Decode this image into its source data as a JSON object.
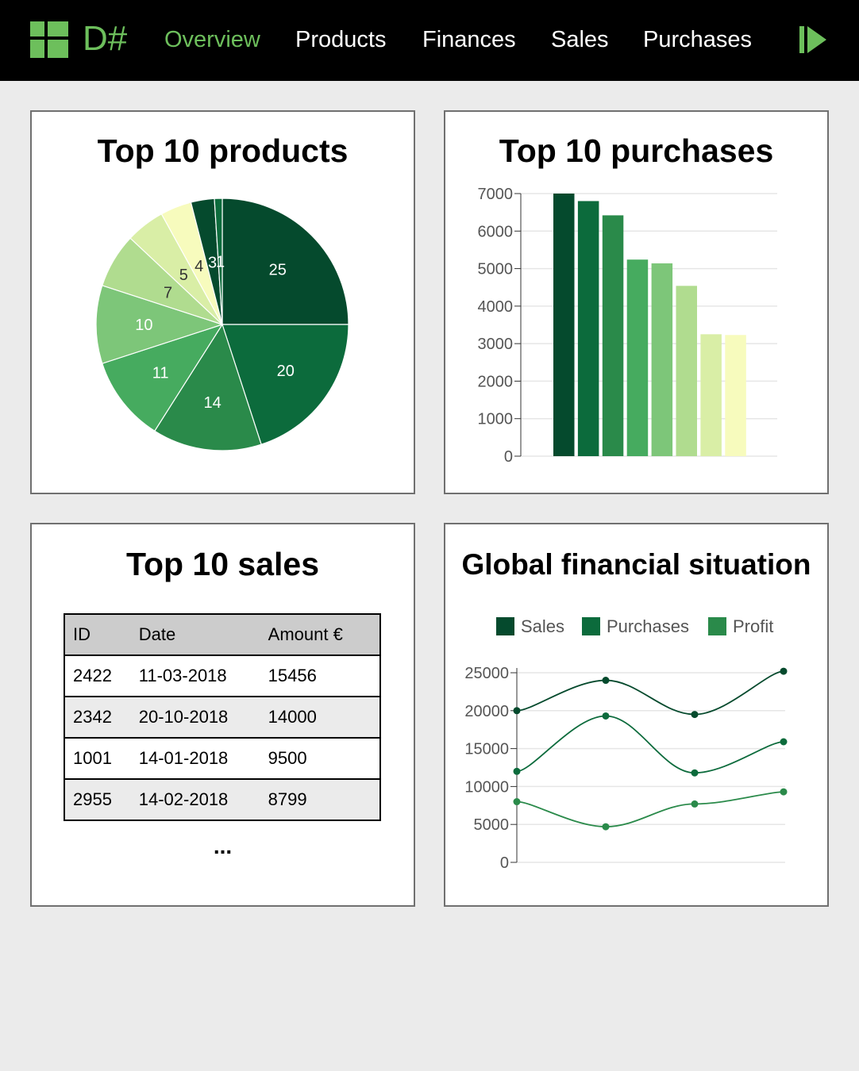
{
  "header": {
    "logo_text": "D#",
    "nav": [
      {
        "label": "Overview",
        "active": true
      },
      {
        "label": "Products",
        "active": false
      },
      {
        "label": "Finances",
        "active": false
      },
      {
        "label": "Sales",
        "active": false
      },
      {
        "label": "Purchases",
        "active": false
      }
    ],
    "logout_icon": "logout-play-icon",
    "accent_color": "#6dbf5c"
  },
  "products_panel": {
    "title": "Top 10 products"
  },
  "purchases_panel": {
    "title": "Top 10 purchases"
  },
  "sales_panel": {
    "title": "Top 10 sales",
    "columns": [
      "ID",
      "Date",
      "Amount €"
    ],
    "rows": [
      [
        "2422",
        "11-03-2018",
        "15456"
      ],
      [
        "2342",
        "20-10-2018",
        "14000"
      ],
      [
        "1001",
        "14-01-2018",
        "9500"
      ],
      [
        "2955",
        "14-02-2018",
        "8799"
      ]
    ],
    "more": "..."
  },
  "finance_panel": {
    "title": "Global financial situation"
  },
  "chart_data": [
    {
      "type": "pie",
      "title": "Top 10 products",
      "values": [
        25,
        20,
        14,
        11,
        10,
        7,
        5,
        4,
        3,
        1
      ],
      "colors": [
        "#054a2d",
        "#0c6b3c",
        "#2a8a4a",
        "#46ab5f",
        "#7dc679",
        "#b0dc8f",
        "#d9eea6",
        "#f7fbbd",
        "#054a2d",
        "#0c6b3c"
      ]
    },
    {
      "type": "bar",
      "title": "Top 10 purchases",
      "values": [
        7000,
        6800,
        6420,
        5240,
        5140,
        4540,
        3250,
        3230
      ],
      "colors": [
        "#054a2d",
        "#0c6b3c",
        "#2a8a4a",
        "#46ab5f",
        "#7dc679",
        "#b0dc8f",
        "#d9eea6",
        "#f7fbbd"
      ],
      "ylim": [
        0,
        7000
      ],
      "yticks": [
        0,
        1000,
        2000,
        3000,
        4000,
        5000,
        6000,
        7000
      ],
      "grid": true
    },
    {
      "type": "line",
      "title": "Global financial situation",
      "x": [
        1,
        2,
        3,
        4
      ],
      "series": [
        {
          "name": "Sales",
          "values": [
            20000,
            24000,
            19500,
            25200
          ],
          "color": "#054a2d"
        },
        {
          "name": "Purchases",
          "values": [
            12000,
            19300,
            11800,
            15900
          ],
          "color": "#0c6b3c"
        },
        {
          "name": "Profit",
          "values": [
            8000,
            4700,
            7700,
            9300
          ],
          "color": "#2a8a4a"
        }
      ],
      "ylim": [
        0,
        25000
      ],
      "yticks": [
        0,
        5000,
        10000,
        15000,
        20000,
        25000
      ],
      "legend": "top",
      "grid": true
    }
  ]
}
